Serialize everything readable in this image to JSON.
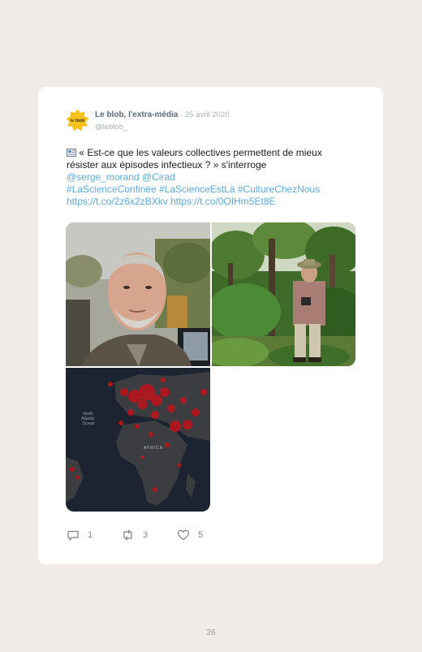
{
  "tweet": {
    "author_name": "Le blob, l'extra-média",
    "date": "· 25 avril 2020",
    "handle": "@leblob_",
    "avatar_text": "le blob",
    "text_line1": "« Est-ce que les valeurs collectives permettent de mieux",
    "text_line2": "résister aux épisodes infectieux ? » s'interroge",
    "mention1": "@serge_morand",
    "mention2": "@Cirad",
    "hashtag1": "#LaScienceConfinée",
    "hashtag2": "#LaScienceEstLà",
    "hashtag3": "#CultureChezNous",
    "url1": "https://t.co/2z6x2zBXkv",
    "url2": "https://t.co/0OIHm5Et8E",
    "map_label_atlantic": "North Atlantic Ocean",
    "map_label_africa": "AFRICA",
    "replies": "1",
    "retweets": "3",
    "likes": "5"
  },
  "page_number": "26",
  "colors": {
    "background": "#f0ebe7",
    "card": "#ffffff",
    "link": "#5aa9e0",
    "map_dots": "#b8141c"
  }
}
